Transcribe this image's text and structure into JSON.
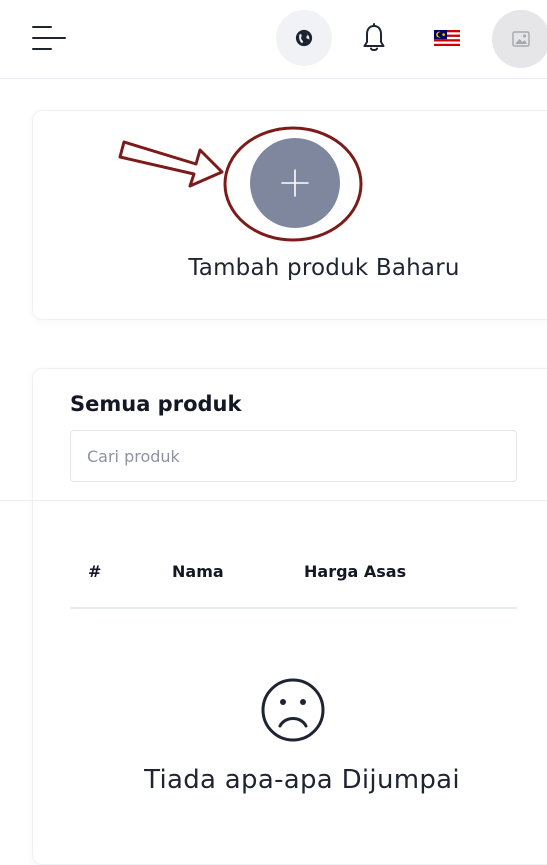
{
  "header": {
    "menu_icon": "hamburger-menu-icon",
    "language_icon": "globe-icon",
    "notification_icon": "bell-icon",
    "locale_flag_icon": "malaysia-flag-icon",
    "avatar_icon": "image-placeholder-icon"
  },
  "add_product": {
    "icon": "plus-icon",
    "label": "Tambah produk Baharu",
    "annotation_color": "#7d1a1a"
  },
  "product_list": {
    "title": "Semua produk",
    "search": {
      "placeholder": "Cari produk",
      "value": ""
    },
    "columns": [
      "#",
      "Nama",
      "Harga Asas"
    ],
    "rows": [],
    "empty_state": {
      "icon": "sad-face-icon",
      "message": "Tiada apa-apa Dijumpai"
    }
  },
  "colors": {
    "accent_button": "#7f879f",
    "text_primary": "#1f2433",
    "annotation": "#7d1a1a"
  }
}
